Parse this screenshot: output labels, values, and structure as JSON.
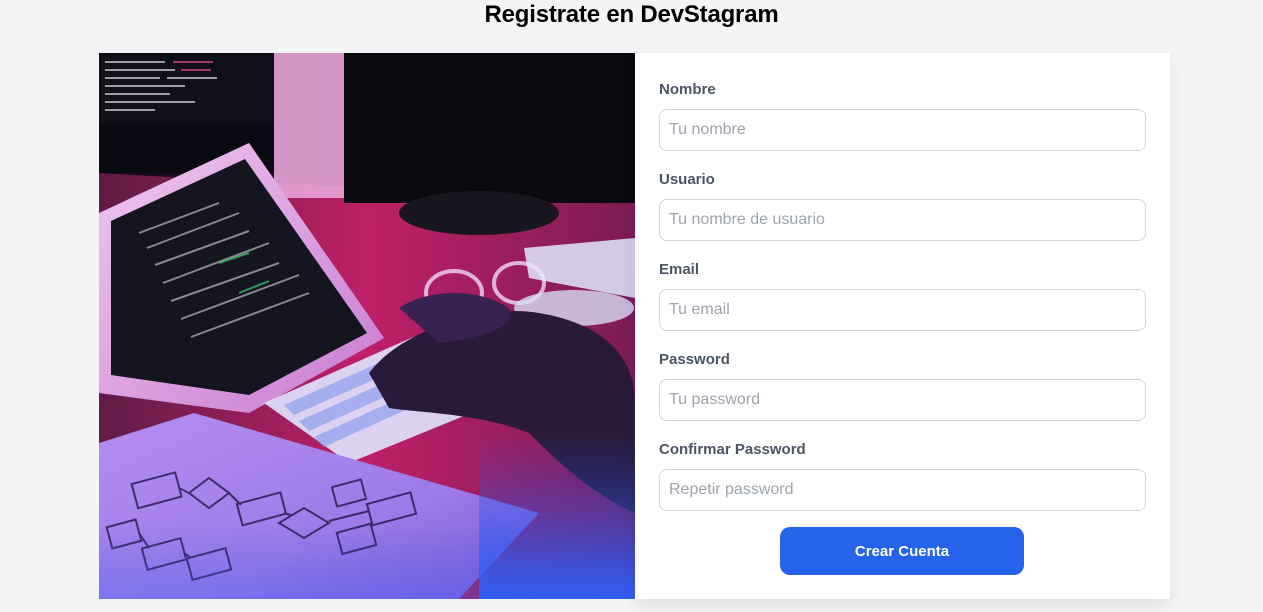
{
  "page": {
    "title": "Registrate en DevStagram"
  },
  "hero_image": {
    "description_icon": "developer-workspace-image"
  },
  "form": {
    "fields": [
      {
        "label": "Nombre",
        "placeholder": "Tu nombre",
        "value": ""
      },
      {
        "label": "Usuario",
        "placeholder": "Tu nombre de usuario",
        "value": ""
      },
      {
        "label": "Email",
        "placeholder": "Tu email",
        "value": ""
      },
      {
        "label": "Password",
        "placeholder": "Tu password",
        "value": ""
      },
      {
        "label": "Confirmar Password",
        "placeholder": "Repetir password",
        "value": ""
      }
    ],
    "submit_label": "Crear Cuenta"
  },
  "colors": {
    "page_background": "#f3f4f6",
    "button": "#2563eb",
    "label": "#4b5563",
    "placeholder": "#9ca3af"
  }
}
